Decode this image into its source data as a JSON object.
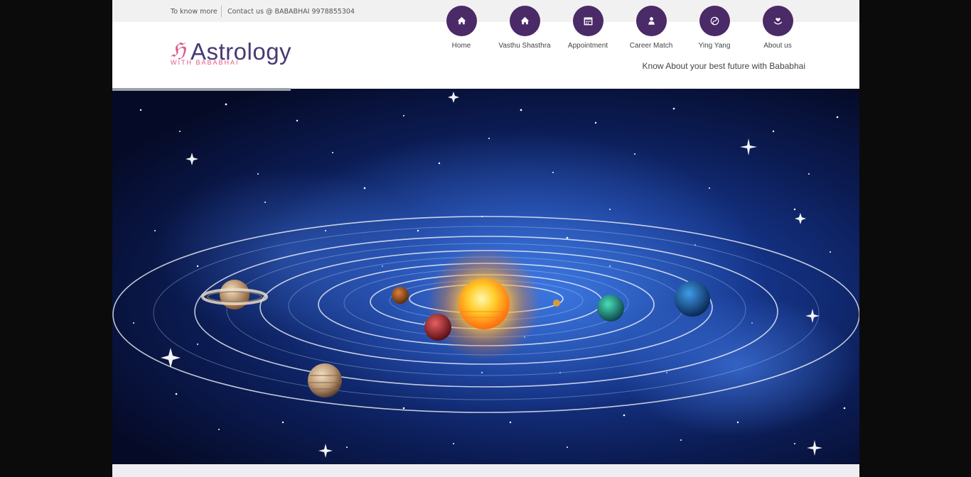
{
  "topbar": {
    "know_more": "To know more",
    "contact": "Contact us @ BABABHAI 9978855304"
  },
  "logo": {
    "mark": "ℌ",
    "title": "Astrology",
    "subtitle": "WITH BABABHAI"
  },
  "nav": {
    "items": [
      {
        "label": "Home",
        "icon": "home-icon"
      },
      {
        "label": "Vasthu Shasthra",
        "icon": "home-icon"
      },
      {
        "label": "Appointment",
        "icon": "calendar-icon"
      },
      {
        "label": "Career Match",
        "icon": "person-icon"
      },
      {
        "label": "Ying Yang",
        "icon": "yin-yang-icon"
      },
      {
        "label": "About us",
        "icon": "heart-hand-icon"
      }
    ]
  },
  "tagline": "Know About your best future with Bababhai",
  "hero": {
    "image": "solar-system-illustration"
  },
  "colors": {
    "brand_purple": "#4b2a68",
    "logo_pink": "#e05a8a",
    "logo_text": "#4a3a73"
  }
}
